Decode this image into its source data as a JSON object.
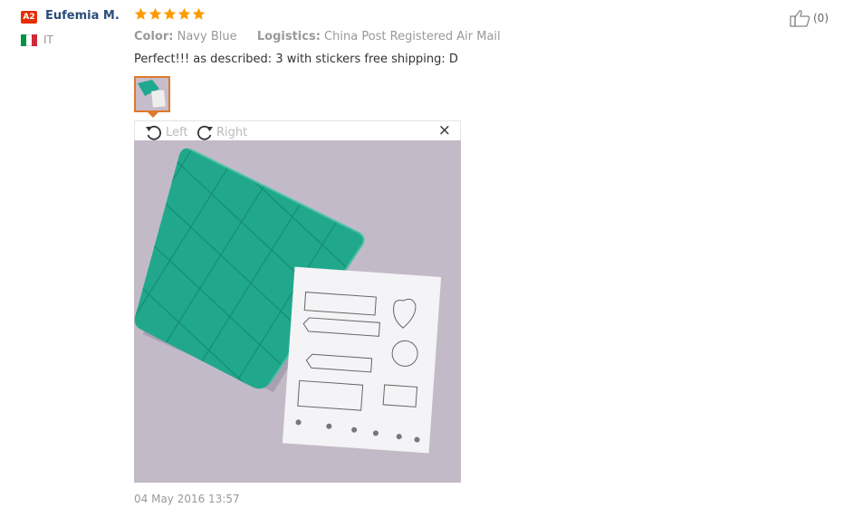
{
  "reviewer": {
    "level_badge": "A2",
    "name": "Eufemia M.",
    "country": "IT",
    "flag_colors": [
      "#009246",
      "#ffffff",
      "#ce2b37"
    ]
  },
  "rating": {
    "stars": 5,
    "max": 5,
    "color": "#ff9a00"
  },
  "attributes": [
    {
      "label": "Color:",
      "value": "Navy Blue"
    },
    {
      "label": "Logistics:",
      "value": "China Post Registered Air Mail"
    }
  ],
  "review_text": "Perfect!!! as described: 3 with stickers free shipping: D",
  "viewer": {
    "rotate_left_label": "Left",
    "rotate_right_label": "Right",
    "close_symbol": "×",
    "photo_subject": "teal quilted photo album with sticker sheet"
  },
  "timestamp": "04 May 2016 13:57",
  "helpful": {
    "count_text": "(0)",
    "icon": "thumbs-up-icon"
  }
}
